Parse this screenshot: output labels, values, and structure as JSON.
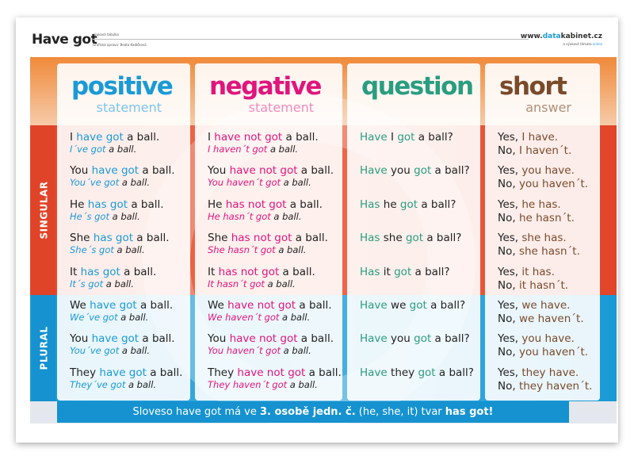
{
  "header": {
    "title": "Have got",
    "subtitle1": "výuková tabulka",
    "subtitle2": "Grafická úprava: Beáta Kadlčková",
    "brand_pre": "www.",
    "brand_accent": "data",
    "brand_post": "kabinet.cz",
    "brand_sub_pre": "a výukové témata ",
    "brand_sub_accent": "online"
  },
  "colors": {
    "positive": "#1a9ad6",
    "negative": "#e0157d",
    "question": "#2a9d80",
    "short": "#7a4a2a",
    "singular": "#e04428",
    "plural": "#1592cf"
  },
  "side": {
    "singular": "SINGULAR",
    "plural": "PLURAL"
  },
  "columns": [
    {
      "key": "positive",
      "title": "positive",
      "subtitle": "statement",
      "rows": [
        {
          "l1": [
            [
              "I ",
              "k"
            ],
            [
              "have got",
              "a"
            ],
            [
              " a ball.",
              "k"
            ]
          ],
          "l2": [
            [
              "I´ve got",
              "a"
            ],
            [
              " a ball.",
              "k"
            ]
          ]
        },
        {
          "l1": [
            [
              "You ",
              "k"
            ],
            [
              "have got",
              "a"
            ],
            [
              " a ball.",
              "k"
            ]
          ],
          "l2": [
            [
              "You´ve got",
              "a"
            ],
            [
              " a ball.",
              "k"
            ]
          ]
        },
        {
          "l1": [
            [
              "He ",
              "k"
            ],
            [
              "has got",
              "a"
            ],
            [
              " a ball.",
              "k"
            ]
          ],
          "l2": [
            [
              "He´s got",
              "a"
            ],
            [
              " a ball.",
              "k"
            ]
          ]
        },
        {
          "l1": [
            [
              "She ",
              "k"
            ],
            [
              "has got",
              "a"
            ],
            [
              " a ball.",
              "k"
            ]
          ],
          "l2": [
            [
              "She´s got",
              "a"
            ],
            [
              " a ball.",
              "k"
            ]
          ]
        },
        {
          "l1": [
            [
              "It ",
              "k"
            ],
            [
              "has got",
              "a"
            ],
            [
              " a ball.",
              "k"
            ]
          ],
          "l2": [
            [
              "It´s got",
              "a"
            ],
            [
              " a ball.",
              "k"
            ]
          ]
        },
        {
          "l1": [
            [
              "We ",
              "k"
            ],
            [
              "have got",
              "a"
            ],
            [
              " a ball.",
              "k"
            ]
          ],
          "l2": [
            [
              "We´ve got",
              "a"
            ],
            [
              " a ball.",
              "k"
            ]
          ]
        },
        {
          "l1": [
            [
              "You ",
              "k"
            ],
            [
              "have got",
              "a"
            ],
            [
              " a ball.",
              "k"
            ]
          ],
          "l2": [
            [
              "You´ve got",
              "a"
            ],
            [
              " a ball.",
              "k"
            ]
          ]
        },
        {
          "l1": [
            [
              "They ",
              "k"
            ],
            [
              "have got",
              "a"
            ],
            [
              " a ball.",
              "k"
            ]
          ],
          "l2": [
            [
              "They´ve got",
              "a"
            ],
            [
              " a ball.",
              "k"
            ]
          ]
        }
      ]
    },
    {
      "key": "negative",
      "title": "negative",
      "subtitle": "statement",
      "rows": [
        {
          "l1": [
            [
              "I ",
              "k"
            ],
            [
              "have not got",
              "a"
            ],
            [
              " a ball.",
              "k"
            ]
          ],
          "l2": [
            [
              "I haven´t got",
              "a"
            ],
            [
              " a ball.",
              "k"
            ]
          ]
        },
        {
          "l1": [
            [
              "You ",
              "k"
            ],
            [
              "have not got",
              "a"
            ],
            [
              " a ball.",
              "k"
            ]
          ],
          "l2": [
            [
              "You haven´t got",
              "a"
            ],
            [
              " a ball.",
              "k"
            ]
          ]
        },
        {
          "l1": [
            [
              "He ",
              "k"
            ],
            [
              "has not got",
              "a"
            ],
            [
              " a ball.",
              "k"
            ]
          ],
          "l2": [
            [
              "He hasn´t got",
              "a"
            ],
            [
              " a ball.",
              "k"
            ]
          ]
        },
        {
          "l1": [
            [
              "She ",
              "k"
            ],
            [
              "has not got",
              "a"
            ],
            [
              " a ball.",
              "k"
            ]
          ],
          "l2": [
            [
              "She hasn´t got",
              "a"
            ],
            [
              " a ball.",
              "k"
            ]
          ]
        },
        {
          "l1": [
            [
              "It ",
              "k"
            ],
            [
              "has not got",
              "a"
            ],
            [
              " a ball.",
              "k"
            ]
          ],
          "l2": [
            [
              "It hasn´t got",
              "a"
            ],
            [
              " a ball.",
              "k"
            ]
          ]
        },
        {
          "l1": [
            [
              "We ",
              "k"
            ],
            [
              "have not got",
              "a"
            ],
            [
              " a ball.",
              "k"
            ]
          ],
          "l2": [
            [
              "We haven´t got",
              "a"
            ],
            [
              " a ball.",
              "k"
            ]
          ]
        },
        {
          "l1": [
            [
              "You ",
              "k"
            ],
            [
              "have not got",
              "a"
            ],
            [
              " a ball.",
              "k"
            ]
          ],
          "l2": [
            [
              "You haven´t got",
              "a"
            ],
            [
              " a ball.",
              "k"
            ]
          ]
        },
        {
          "l1": [
            [
              "They ",
              "k"
            ],
            [
              "have not got",
              "a"
            ],
            [
              " a ball.",
              "k"
            ]
          ],
          "l2": [
            [
              "They haven´t got",
              "a"
            ],
            [
              " a ball.",
              "k"
            ]
          ]
        }
      ]
    },
    {
      "key": "question",
      "title": "question",
      "subtitle": "",
      "rows": [
        {
          "l1": [
            [
              "Have",
              "a"
            ],
            [
              " I ",
              "k"
            ],
            [
              "got",
              "a"
            ],
            [
              " a ball?",
              "k"
            ]
          ]
        },
        {
          "l1": [
            [
              "Have",
              "a"
            ],
            [
              " you ",
              "k"
            ],
            [
              "got",
              "a"
            ],
            [
              " a ball?",
              "k"
            ]
          ]
        },
        {
          "l1": [
            [
              "Has",
              "a"
            ],
            [
              " he ",
              "k"
            ],
            [
              "got",
              "a"
            ],
            [
              " a ball?",
              "k"
            ]
          ]
        },
        {
          "l1": [
            [
              "Has",
              "a"
            ],
            [
              " she ",
              "k"
            ],
            [
              "got",
              "a"
            ],
            [
              " a ball?",
              "k"
            ]
          ]
        },
        {
          "l1": [
            [
              "Has",
              "a"
            ],
            [
              " it ",
              "k"
            ],
            [
              "got",
              "a"
            ],
            [
              " a ball?",
              "k"
            ]
          ]
        },
        {
          "l1": [
            [
              "Have",
              "a"
            ],
            [
              " we ",
              "k"
            ],
            [
              "got",
              "a"
            ],
            [
              " a ball?",
              "k"
            ]
          ]
        },
        {
          "l1": [
            [
              "Have",
              "a"
            ],
            [
              " you ",
              "k"
            ],
            [
              "got",
              "a"
            ],
            [
              " a ball?",
              "k"
            ]
          ]
        },
        {
          "l1": [
            [
              "Have",
              "a"
            ],
            [
              " they ",
              "k"
            ],
            [
              "got",
              "a"
            ],
            [
              " a ball?",
              "k"
            ]
          ]
        }
      ]
    },
    {
      "key": "short",
      "title": "short",
      "subtitle": "answer",
      "rows": [
        {
          "l1": [
            [
              "Yes, ",
              "k"
            ],
            [
              "I have.",
              "a"
            ]
          ],
          "l2": [
            [
              "No, ",
              "k"
            ],
            [
              "I haven´t.",
              "a"
            ]
          ]
        },
        {
          "l1": [
            [
              "Yes, ",
              "k"
            ],
            [
              "you have.",
              "a"
            ]
          ],
          "l2": [
            [
              "No, ",
              "k"
            ],
            [
              "you haven´t.",
              "a"
            ]
          ]
        },
        {
          "l1": [
            [
              "Yes, ",
              "k"
            ],
            [
              "he has.",
              "a"
            ]
          ],
          "l2": [
            [
              "No, ",
              "k"
            ],
            [
              "he hasn´t.",
              "a"
            ]
          ]
        },
        {
          "l1": [
            [
              "Yes, ",
              "k"
            ],
            [
              "she has.",
              "a"
            ]
          ],
          "l2": [
            [
              "No, ",
              "k"
            ],
            [
              "she hasn´t.",
              "a"
            ]
          ]
        },
        {
          "l1": [
            [
              "Yes, ",
              "k"
            ],
            [
              "it has.",
              "a"
            ]
          ],
          "l2": [
            [
              "No, ",
              "k"
            ],
            [
              "it hasn´t.",
              "a"
            ]
          ]
        },
        {
          "l1": [
            [
              "Yes, ",
              "k"
            ],
            [
              "we have.",
              "a"
            ]
          ],
          "l2": [
            [
              "No, ",
              "k"
            ],
            [
              "we haven´t.",
              "a"
            ]
          ]
        },
        {
          "l1": [
            [
              "Yes, ",
              "k"
            ],
            [
              "you have.",
              "a"
            ]
          ],
          "l2": [
            [
              "No, ",
              "k"
            ],
            [
              "you haven´t.",
              "a"
            ]
          ]
        },
        {
          "l1": [
            [
              "Yes, ",
              "k"
            ],
            [
              "they have.",
              "a"
            ]
          ],
          "l2": [
            [
              "No, ",
              "k"
            ],
            [
              "they haven´t.",
              "a"
            ]
          ]
        }
      ]
    }
  ],
  "footer": {
    "p1": "Sloveso have got má ve ",
    "b1": "3. osobě jedn. č.",
    "p2": " (he, she, it) tvar ",
    "b2": "has got!"
  }
}
